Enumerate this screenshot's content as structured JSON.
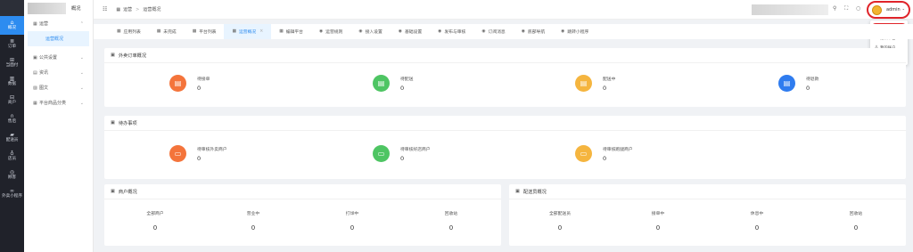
{
  "sidebar": {
    "items": [
      {
        "icon": "home-icon",
        "glyph": "⌂",
        "label": "概况"
      },
      {
        "icon": "list-icon",
        "glyph": "≣",
        "label": "订单"
      },
      {
        "icon": "wallet-icon",
        "glyph": "⊞",
        "label": "当面付"
      },
      {
        "icon": "chart-icon",
        "glyph": "▥",
        "label": "数据"
      },
      {
        "icon": "shop-icon",
        "glyph": "⊟",
        "label": "商户"
      },
      {
        "icon": "headset-icon",
        "glyph": "∩",
        "label": "售后"
      },
      {
        "icon": "truck-icon",
        "glyph": "▰",
        "label": "配送员"
      },
      {
        "icon": "user-icon",
        "glyph": "♁",
        "label": "店员"
      },
      {
        "icon": "coin-icon",
        "glyph": "◎",
        "label": "顾客"
      },
      {
        "icon": "miniapp-icon",
        "glyph": "∞",
        "label": "外卖小程序"
      }
    ]
  },
  "subsidebar": {
    "title": "概况",
    "groups": [
      {
        "label": "运营",
        "icon": "grid-icon",
        "glyph": "▦",
        "expanded": true,
        "children": [
          {
            "label": "运营概况"
          }
        ]
      },
      {
        "label": "公共设置",
        "icon": "image-icon",
        "glyph": "▣"
      },
      {
        "label": "资讯",
        "icon": "doc-icon",
        "glyph": "▤"
      },
      {
        "label": "图文",
        "icon": "picture-icon",
        "glyph": "▨"
      },
      {
        "label": "平台商品分类",
        "icon": "category-icon",
        "glyph": "▦"
      }
    ]
  },
  "header": {
    "breadcrumb": [
      "运营",
      "运营概况"
    ],
    "user": {
      "name": "admin"
    }
  },
  "user_menu": [
    "切换平台",
    "编辑平台",
    "我的账户",
    "退出登录"
  ],
  "tabs": [
    {
      "label": "应用列表",
      "glyph": "▦"
    },
    {
      "label": "未完成",
      "glyph": "▦"
    },
    {
      "label": "平台列表",
      "glyph": "▦"
    },
    {
      "label": "运营概况",
      "glyph": "▦",
      "active": true,
      "closable": true
    },
    {
      "label": "编辑平台",
      "glyph": "▦"
    },
    {
      "label": "运营规则",
      "glyph": "◉"
    },
    {
      "label": "接入设置",
      "glyph": "◉"
    },
    {
      "label": "基础设置",
      "glyph": "◉"
    },
    {
      "label": "发布与审核",
      "glyph": "◉"
    },
    {
      "label": "订阅消息",
      "glyph": "◉"
    },
    {
      "label": "底部导航",
      "glyph": "◉"
    },
    {
      "label": "跳转小程序",
      "glyph": "◉"
    }
  ],
  "order_overview": {
    "title": "外卖订单概况",
    "stats": [
      {
        "label": "待接单",
        "value": "0",
        "color": "#f4743b"
      },
      {
        "label": "待配送",
        "value": "0",
        "color": "#4ec563"
      },
      {
        "label": "配送中",
        "value": "0",
        "color": "#f5b53f"
      },
      {
        "label": "待退款",
        "value": "0",
        "color": "#2f7cef"
      }
    ]
  },
  "todo": {
    "title": "待办事项",
    "stats": [
      {
        "label": "待审核外卖商户",
        "value": "0",
        "color": "#f4743b"
      },
      {
        "label": "待审核好店商户",
        "value": "0",
        "color": "#4ec563"
      },
      {
        "label": "待审核跑腿商户",
        "value": "0",
        "color": "#f5b53f"
      }
    ]
  },
  "merchant_overview": {
    "title": "商户概况",
    "cells": [
      {
        "label": "全部商户",
        "value": "0"
      },
      {
        "label": "营业中",
        "value": "0"
      },
      {
        "label": "打烊中",
        "value": "0"
      },
      {
        "label": "回收站",
        "value": "0"
      }
    ]
  },
  "courier_overview": {
    "title": "配送员概况",
    "cells": [
      {
        "label": "全部配送员",
        "value": "0"
      },
      {
        "label": "接单中",
        "value": "0"
      },
      {
        "label": "休息中",
        "value": "0"
      },
      {
        "label": "回收站",
        "value": "0"
      }
    ]
  }
}
